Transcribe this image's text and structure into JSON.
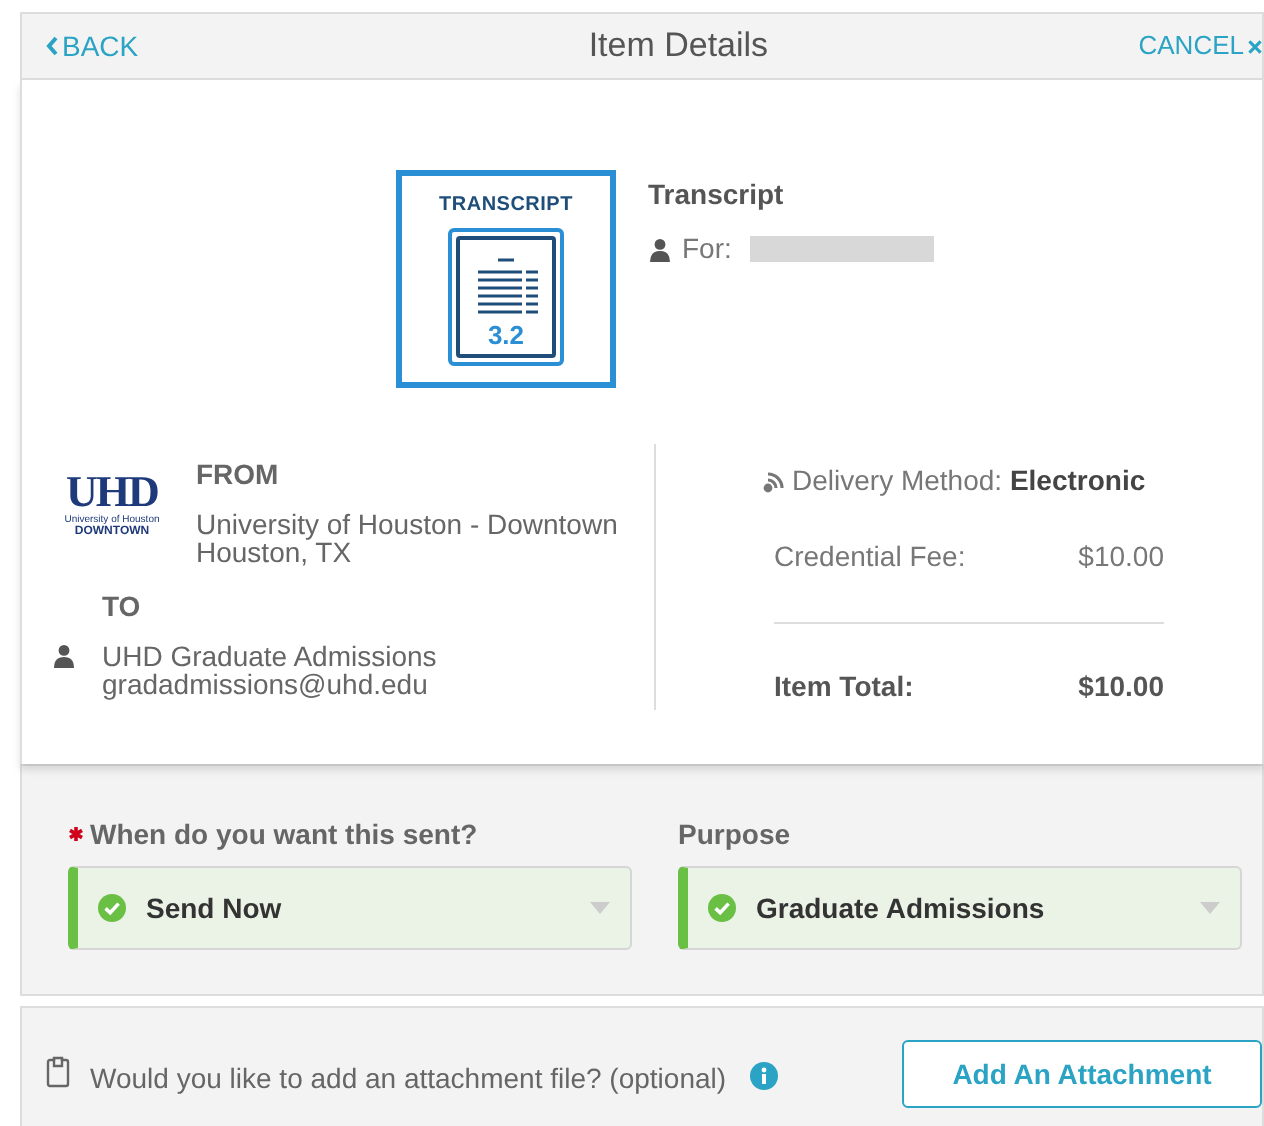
{
  "header": {
    "back": "BACK",
    "title": "Item Details",
    "cancel": "CANCEL"
  },
  "item": {
    "badge_title": "TRANSCRIPT",
    "badge_version": "3.2",
    "name": "Transcript",
    "for_label": "For:",
    "for_value_redacted": true
  },
  "from": {
    "label": "FROM",
    "logo": {
      "mark": "UHD",
      "line1": "University of Houston",
      "line2": "DOWNTOWN"
    },
    "name": "University of Houston - Downtown",
    "location": "Houston, TX"
  },
  "to": {
    "label": "TO",
    "name": "UHD Graduate Admissions",
    "email": "gradadmissions@uhd.edu"
  },
  "delivery": {
    "label": "Delivery Method:",
    "value": "Electronic"
  },
  "fees": [
    {
      "label": "Credential Fee:",
      "amount": "$10.00",
      "kind": "line"
    },
    {
      "label": "Item Total:",
      "amount": "$10.00",
      "kind": "total"
    }
  ],
  "fields": [
    {
      "label": "When do you want this sent?",
      "required": true,
      "value": "Send Now",
      "valid": true
    },
    {
      "label": "Purpose",
      "required": false,
      "value": "Graduate Admissions",
      "valid": true
    }
  ],
  "attachment": {
    "prompt": "Would you like to add an attachment file? (optional)",
    "button": "Add An Attachment"
  }
}
